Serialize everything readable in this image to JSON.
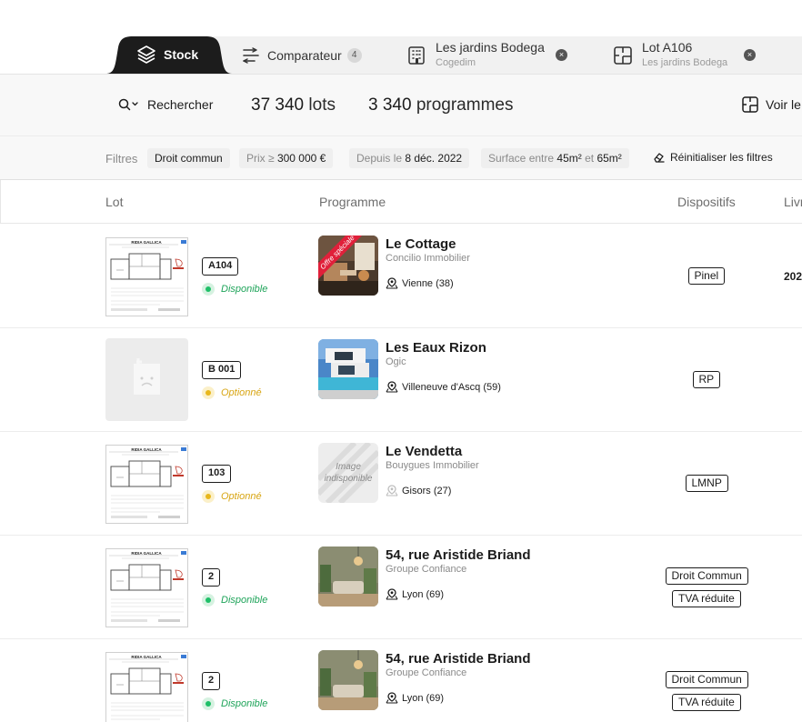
{
  "tabs": {
    "stock": {
      "label": "Stock"
    },
    "comparateur": {
      "label": "Comparateur",
      "count": "4"
    },
    "programme": {
      "label": "Les jardins Bodega",
      "sub": "Cogedim",
      "close": "×"
    },
    "lot": {
      "label": "Lot A106",
      "sub": "Les jardins Bodega",
      "close": "×"
    }
  },
  "summary": {
    "search_label": "Rechercher",
    "lots_count": "37 340",
    "lots_unit": "lots",
    "programmes_count": "3 340",
    "programmes_unit": "programmes",
    "voir_label": "Voir le"
  },
  "filters": {
    "label": "Filtres",
    "regime": "Droit commun",
    "prix_key": "Prix",
    "prix_op": "≥",
    "prix_value": "300 000 €",
    "depuis_key": "Depuis le",
    "depuis_value": "8 déc. 2022",
    "surface_key": "Surface entre",
    "surface_min": "45m²",
    "surface_and": "et",
    "surface_max": "65m²",
    "reset_label": "Réinitialiser les filtres"
  },
  "columns": {
    "lot": "Lot",
    "programme": "Programme",
    "dispositifs": "Dispositifs",
    "livraison": "Livr"
  },
  "plan_title": "RIDIA GALLICA",
  "placeholder_image_text": "Image indisponible",
  "promo_ribbon": "Offre spéciale",
  "rows": [
    {
      "lot": "A104",
      "status": "Disponible",
      "status_color": "green",
      "programme": "Le Cottage",
      "developer": "Concilio Immobilier",
      "location": "Vienne (38)",
      "dispositifs": [
        "Pinel"
      ],
      "livraison": "202",
      "has_plan": true,
      "thumb": "cottage",
      "promo": true
    },
    {
      "lot": "B 001",
      "status": "Optionné",
      "status_color": "yellow",
      "programme": "Les Eaux Rizon",
      "developer": "Ogic",
      "location": "Villeneuve d'Ascq (59)",
      "dispositifs": [
        "RP"
      ],
      "livraison": "",
      "has_plan": false,
      "thumb": "villa",
      "promo": false
    },
    {
      "lot": "103",
      "status": "Optionné",
      "status_color": "yellow",
      "programme": "Le Vendetta",
      "developer": "Bouygues Immobilier",
      "location": "Gisors (27)",
      "dispositifs": [
        "LMNP"
      ],
      "livraison": "",
      "has_plan": true,
      "thumb": "none",
      "promo": false
    },
    {
      "lot": "2",
      "status": "Disponible",
      "status_color": "green",
      "programme": "54, rue Aristide Briand",
      "developer": "Groupe Confiance",
      "location": "Lyon (69)",
      "dispositifs": [
        "Droit Commun",
        "TVA réduite"
      ],
      "livraison": "",
      "has_plan": true,
      "thumb": "interior",
      "promo": false
    },
    {
      "lot": "2",
      "status": "Disponible",
      "status_color": "green",
      "programme": "54, rue Aristide Briand",
      "developer": "Groupe Confiance",
      "location": "Lyon (69)",
      "dispositifs": [
        "Droit Commun",
        "TVA réduite"
      ],
      "livraison": "",
      "has_plan": true,
      "thumb": "interior",
      "promo": false
    }
  ],
  "colors": {
    "accent_dark": "#1c1c1c",
    "status_green": "#1fbf68",
    "status_yellow": "#e8b71c",
    "promo_red": "#e0203a"
  }
}
